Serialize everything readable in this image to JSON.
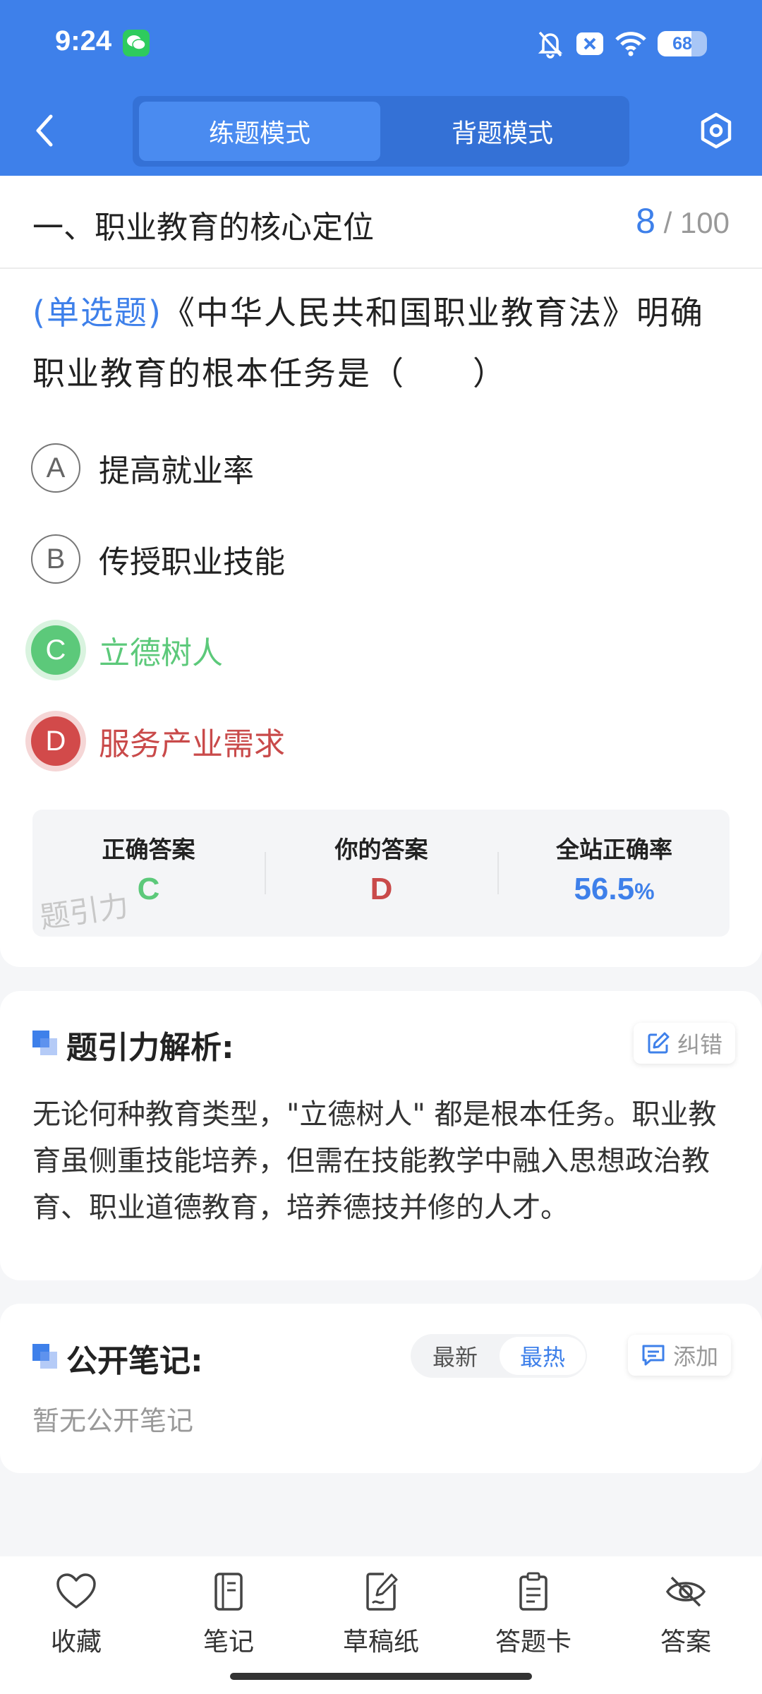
{
  "status_bar": {
    "time": "9:24",
    "battery": "68"
  },
  "header": {
    "tabs": [
      {
        "label": "练题模式"
      },
      {
        "label": "背题模式"
      }
    ]
  },
  "question_header": {
    "section_title": "一、职业教育的核心定位",
    "current": "8",
    "separator": "/",
    "total": "100"
  },
  "question": {
    "type_tag": "(单选题)",
    "text": "《中华人民共和国职业教育法》明确职业教育的根本任务是（　　）",
    "options": [
      {
        "letter": "A",
        "text": "提高就业率"
      },
      {
        "letter": "B",
        "text": "传授职业技能"
      },
      {
        "letter": "C",
        "text": "立德树人"
      },
      {
        "letter": "D",
        "text": "服务产业需求"
      }
    ]
  },
  "stats": {
    "correct_label": "正确答案",
    "correct_value": "C",
    "yours_label": "你的答案",
    "yours_value": "D",
    "rate_label": "全站正确率",
    "rate_value": "56.5",
    "rate_unit": "%",
    "watermark": "题引力"
  },
  "analysis": {
    "title": "题引力解析:",
    "report_label": "纠错",
    "text": "无论何种教育类型，\"立德树人\" 都是根本任务。职业教育虽侧重技能培养，但需在技能教学中融入思想政治教育、职业道德教育，培养德技并修的人才。"
  },
  "notes": {
    "title": "公开笔记:",
    "sort_options": [
      "最新",
      "最热"
    ],
    "add_label": "添加",
    "empty_text": "暂无公开笔记"
  },
  "bottom_nav": [
    {
      "label": "收藏",
      "icon": "heart-icon"
    },
    {
      "label": "笔记",
      "icon": "notebook-icon"
    },
    {
      "label": "草稿纸",
      "icon": "draft-icon"
    },
    {
      "label": "答题卡",
      "icon": "clipboard-icon"
    },
    {
      "label": "答案",
      "icon": "eye-off-icon"
    }
  ],
  "colors": {
    "primary": "#3e80ea",
    "correct": "#5cc97a",
    "wrong": "#d24a4a"
  }
}
